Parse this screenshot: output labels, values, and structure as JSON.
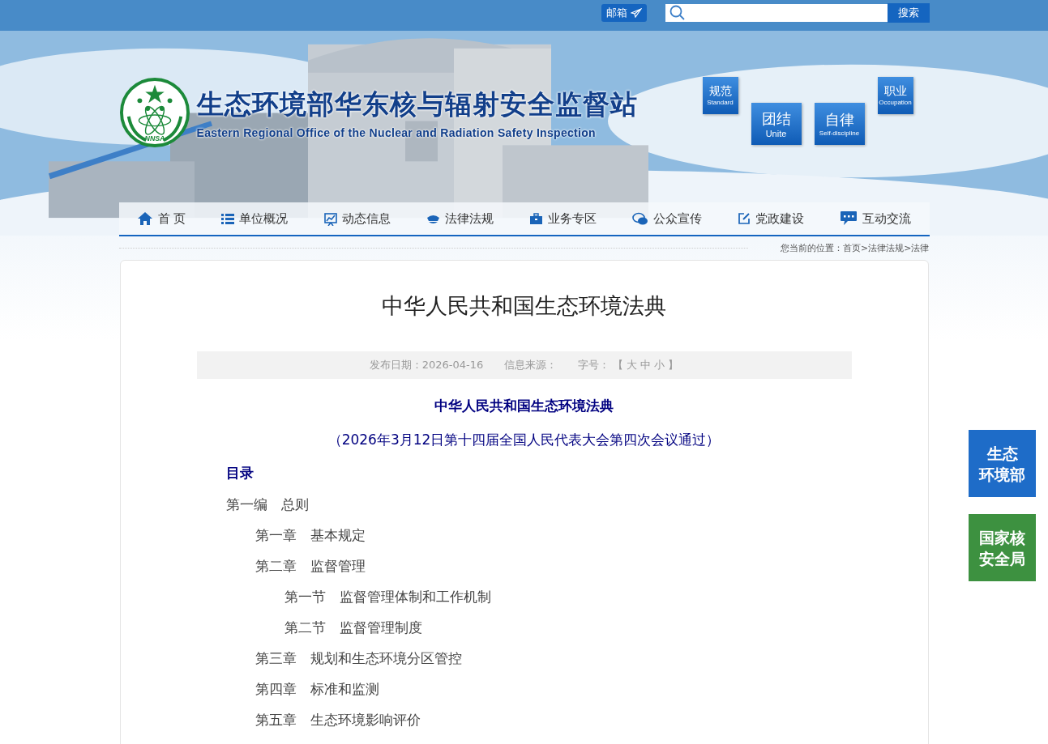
{
  "top_bar": {
    "mail_button": "邮箱",
    "search": {
      "button": "搜索"
    }
  },
  "header": {
    "logo_text": "NNSA",
    "title": "生态环境部华东核与辐射安全监督站",
    "subtitle": "Eastern Regional Office of the Nuclear and Radiation Safety Inspection",
    "tiles": [
      {
        "cn": "规范",
        "en": "Standard",
        "kind": "small"
      },
      {
        "cn": "团结",
        "en": "Unite",
        "kind": "large"
      },
      {
        "cn": "自律",
        "en": "Self-discipline",
        "kind": "large"
      },
      {
        "cn": "职业",
        "en": "Occupation",
        "kind": "small"
      }
    ]
  },
  "nav": [
    {
      "label": "首 页",
      "kind": "home"
    },
    {
      "label": "单位概况",
      "kind": "list"
    },
    {
      "label": "动态信息",
      "kind": "chart"
    },
    {
      "label": "法律法规",
      "kind": "cap"
    },
    {
      "label": "业务专区",
      "kind": "case"
    },
    {
      "label": "公众宣传",
      "kind": "chat"
    },
    {
      "label": "党政建设",
      "kind": "edit"
    },
    {
      "label": "互动交流",
      "kind": "talk"
    }
  ],
  "breadcrumb": "您当前的位置：首页>法律法规>法律",
  "article": {
    "title": "中华人民共和国生态环境法典",
    "meta": {
      "date": "发布日期：2026-04-16",
      "source": "信息来源：",
      "font_label": "字号：",
      "open": "【",
      "sizes": [
        "大",
        "中",
        "小"
      ],
      "close": "】"
    },
    "heading": "中华人民共和国生态环境法典",
    "note": "（2026年3月12日第十四届全国人民代表大会第四次会议通过）",
    "toc_title": "目录",
    "toc": [
      {
        "text": "第一编　总则",
        "children": [
          {
            "text": "第一章　基本规定"
          },
          {
            "text": "第二章　监督管理",
            "children": [
              {
                "text": "第一节　监督管理体制和工作机制"
              },
              {
                "text": "第二节　监督管理制度"
              }
            ]
          },
          {
            "text": "第三章　规划和生态环境分区管控"
          },
          {
            "text": "第四章　标准和监测"
          },
          {
            "text": "第五章　生态环境影响评价"
          }
        ]
      }
    ]
  },
  "side_links": [
    {
      "lines": [
        "生态",
        "环境部"
      ],
      "color": "#1e6cc8"
    },
    {
      "lines": [
        "国家核",
        "安全局"
      ],
      "color": "#3d9140"
    }
  ]
}
